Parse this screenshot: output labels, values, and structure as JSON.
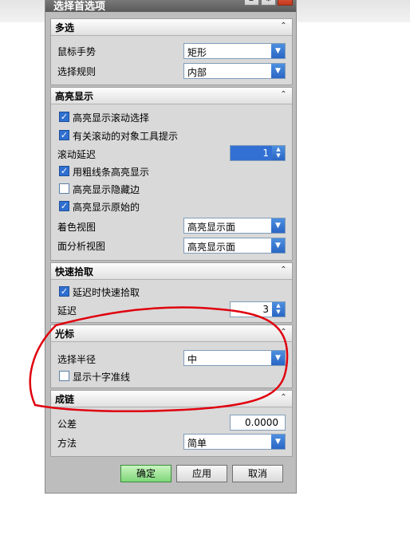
{
  "window": {
    "title": "选择首选项",
    "btn_help": "3",
    "btn_settings_icon": "gear-icon",
    "btn_close_icon": "close-icon"
  },
  "sections": {
    "multiselect": {
      "title": "多选",
      "rows": [
        {
          "label": "鼠标手势",
          "value": "矩形"
        },
        {
          "label": "选择规则",
          "value": "内部"
        }
      ]
    },
    "highlight": {
      "title": "高亮显示",
      "cb_scroll_select": {
        "label": "高亮显示滚动选择",
        "checked": true
      },
      "cb_tooltip": {
        "label": "有关滚动的对象工具提示",
        "checked": true
      },
      "delay": {
        "label": "滚动延迟",
        "value": "1"
      },
      "cb_thick_line": {
        "label": "用粗线条高亮显示",
        "checked": true
      },
      "cb_hidden_edges": {
        "label": "高亮显示隐藏边",
        "checked": false
      },
      "cb_original": {
        "label": "高亮显示原始的",
        "checked": true
      },
      "shaded_view": {
        "label": "着色视图",
        "value": "高亮显示面"
      },
      "analysis_view": {
        "label": "面分析视图",
        "value": "高亮显示面"
      }
    },
    "quickpick": {
      "title": "快速拾取",
      "cb_delay_pick": {
        "label": "延迟时快速拾取",
        "checked": true
      },
      "delay": {
        "label": "延迟",
        "value": "3"
      }
    },
    "cursor": {
      "title": "光标",
      "radius": {
        "label": "选择半径",
        "value": "中"
      },
      "cb_crosshair": {
        "label": "显示十字准线",
        "checked": false
      }
    },
    "chaining": {
      "title": "成链",
      "tolerance": {
        "label": "公差",
        "value": "0.0000"
      },
      "method": {
        "label": "方法",
        "value": "简单"
      }
    }
  },
  "buttons": {
    "ok": "确定",
    "apply": "应用",
    "cancel": "取消"
  },
  "annotation_color": "#e0000e"
}
